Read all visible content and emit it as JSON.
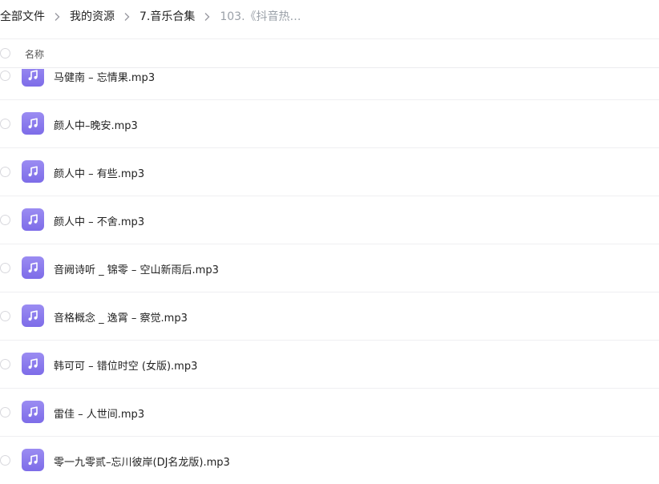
{
  "breadcrumb": {
    "items": [
      "全部文件",
      "我的资源",
      "7.音乐合集",
      "103.《抖音热…"
    ]
  },
  "list": {
    "header": {
      "name_label": "名称"
    },
    "files": [
      {
        "name": "马健南 – 忘情果.mp3"
      },
      {
        "name": "颜人中–晚安.mp3"
      },
      {
        "name": "颜人中 – 有些.mp3"
      },
      {
        "name": "颜人中 – 不舍.mp3"
      },
      {
        "name": "音阙诗听 _ 锦零 – 空山新雨后.mp3"
      },
      {
        "name": "音格概念 _ 逸霄 – 察觉.mp3"
      },
      {
        "name": "韩可可 – 错位时空 (女版).mp3"
      },
      {
        "name": "雷佳 – 人世间.mp3"
      },
      {
        "name": "零一九零贰–忘川彼岸(DJ名龙版).mp3"
      }
    ]
  },
  "icons": {
    "file_type": "music-note-icon",
    "separator": "chevron-right-icon"
  },
  "colors": {
    "icon_bg": "#8a7aee",
    "current_crumb": "#9aa0a8"
  }
}
